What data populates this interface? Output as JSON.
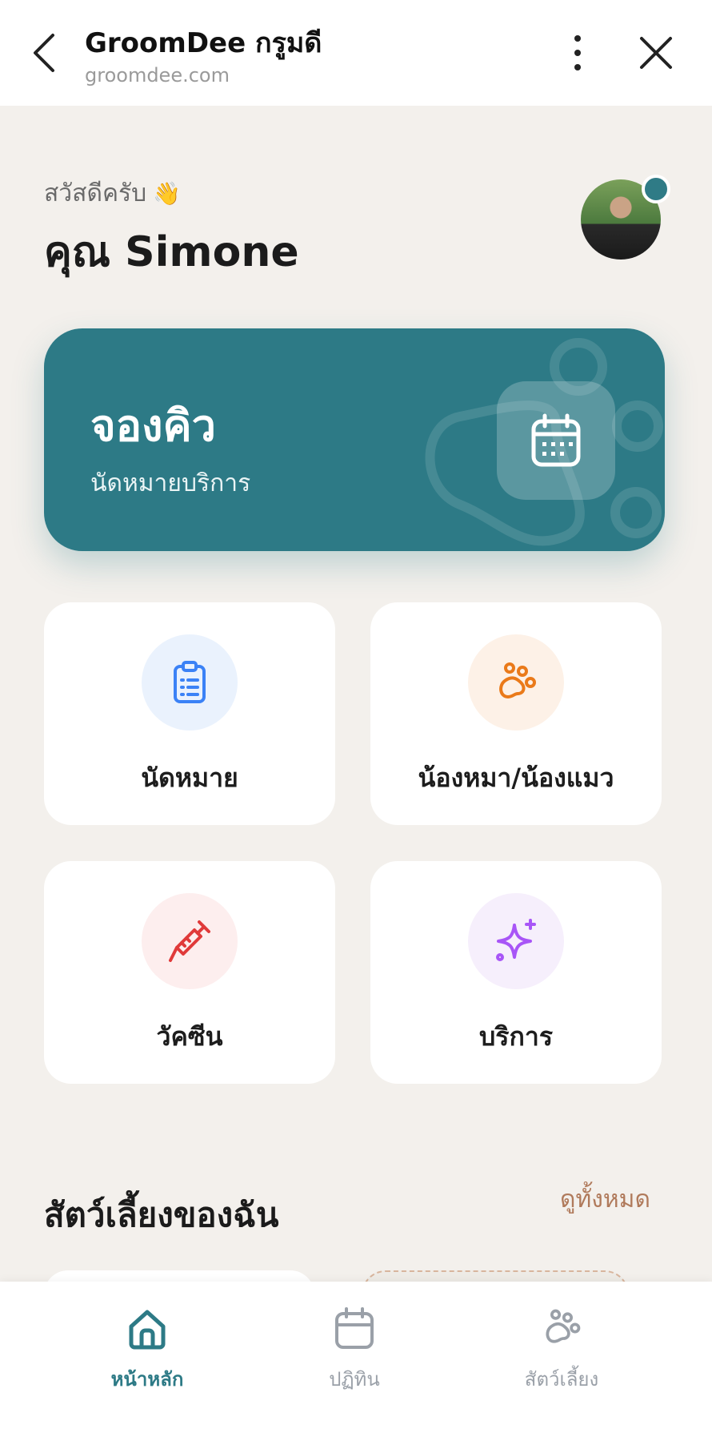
{
  "browser": {
    "title": "GroomDee กรูมดี",
    "url": "groomdee.com"
  },
  "greeting": {
    "hello": "สวัสดีครับ",
    "wave_emoji": "👋",
    "name": "คุณ Simone"
  },
  "booking": {
    "title": "จองคิว",
    "subtitle": "นัดหมายบริการ"
  },
  "tiles": [
    {
      "label": "นัดหมาย",
      "icon": "clipboard-icon",
      "bg": "#eaf2fd",
      "color": "#3b82f6"
    },
    {
      "label": "น้องหมา/น้องแมว",
      "icon": "paw-icon",
      "bg": "#fdf1e7",
      "color": "#ea7a1a"
    },
    {
      "label": "วัคซีน",
      "icon": "syringe-icon",
      "bg": "#fdeeee",
      "color": "#e03a3a"
    },
    {
      "label": "บริการ",
      "icon": "sparkle-icon",
      "bg": "#f6effc",
      "color": "#a855f7"
    }
  ],
  "pets_section": {
    "title": "สัตว์เลี้ยงของฉัน",
    "see_all": "ดูทั้งหมด"
  },
  "nav": [
    {
      "label": "หน้าหลัก",
      "icon": "home-icon",
      "active": true
    },
    {
      "label": "ปฏิทิน",
      "icon": "calendar-icon",
      "active": false
    },
    {
      "label": "สัตว์เลี้ยง",
      "icon": "paw-icon",
      "active": false
    }
  ],
  "colors": {
    "accent": "#2d7a86",
    "background": "#f3f0ec",
    "link": "#b07a5b",
    "nav_inactive": "#9aa0a8"
  }
}
